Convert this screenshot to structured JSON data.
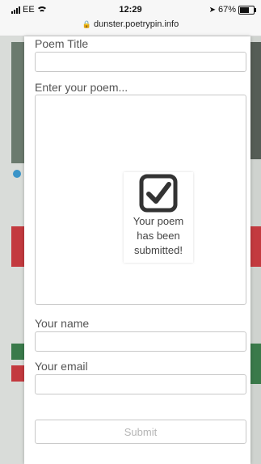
{
  "status_bar": {
    "carrier": "EE",
    "time": "12:29",
    "battery": "67%",
    "battery_level": 0.67
  },
  "browser": {
    "url": "dunster.poetrypin.info"
  },
  "form": {
    "title_label": "Poem Title",
    "title_value": "",
    "poem_label": "Enter your poem...",
    "poem_value": "",
    "name_label": "Your name",
    "name_value": "",
    "email_label": "Your email",
    "email_value": "",
    "submit_label": "Submit"
  },
  "confirmation": {
    "message": "Your poem has been submitted!",
    "icon": "checked-checkbox-icon"
  }
}
